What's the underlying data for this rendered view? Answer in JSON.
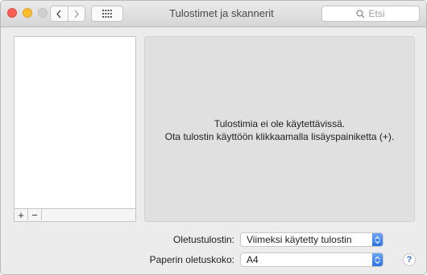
{
  "window": {
    "title": "Tulostimet ja skannerit",
    "search_placeholder": "Etsi"
  },
  "printer_list": {
    "add_label": "+",
    "remove_label": "−"
  },
  "panel": {
    "message_line1": "Tulostimia ei ole käytettävissä.",
    "message_line2": "Ota tulostin käyttöön klikkaamalla lisäyspainiketta (+)."
  },
  "settings": {
    "default_printer_label": "Oletustulostin:",
    "default_printer_value": "Viimeksi käytetty tulostin",
    "paper_size_label": "Paperin oletuskoko:",
    "paper_size_value": "A4"
  },
  "help": {
    "label": "?"
  },
  "colors": {
    "accent": "#2f71e6",
    "close": "#fd5f57",
    "minimize": "#febc2e",
    "zoom_disabled": "#d0d0d0"
  }
}
